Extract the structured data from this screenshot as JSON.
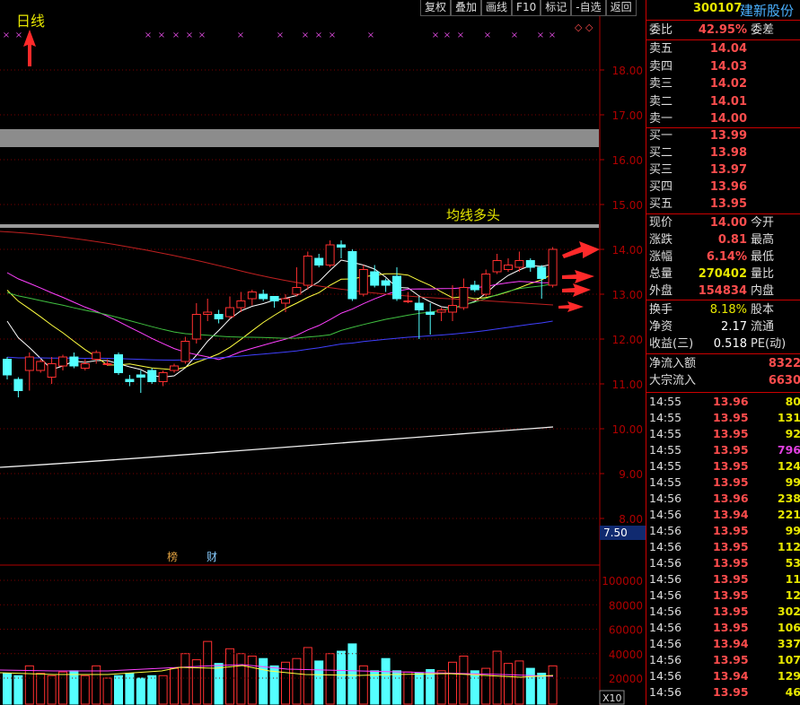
{
  "toolbar": {
    "buttons": [
      "复权",
      "叠加",
      "画线",
      "F10",
      "标记",
      "-自选",
      "返回"
    ]
  },
  "chart": {
    "period_label": "日线",
    "annotation": "均线多头",
    "price_axis": [
      "18.00",
      "17.00",
      "16.00",
      "15.00",
      "14.00",
      "13.00",
      "12.00",
      "11.00",
      "10.00",
      "9.00",
      "8.00"
    ],
    "price_tag": "7.50",
    "event_marks": [
      "榜",
      "财"
    ],
    "volume_axis": [
      "100000",
      "80000",
      "60000",
      "40000",
      "20000"
    ],
    "volume_unit": "X10"
  },
  "quote": {
    "code": "300107",
    "name": "建新股份",
    "weibi_label": "委比",
    "weibi_value": "42.95%",
    "weicha_label": "委差",
    "asks": [
      {
        "label": "卖五",
        "price": "14.04"
      },
      {
        "label": "卖四",
        "price": "14.03"
      },
      {
        "label": "卖三",
        "price": "14.02"
      },
      {
        "label": "卖二",
        "price": "14.01"
      },
      {
        "label": "卖一",
        "price": "14.00"
      }
    ],
    "bids": [
      {
        "label": "买一",
        "price": "13.99"
      },
      {
        "label": "买二",
        "price": "13.98"
      },
      {
        "label": "买三",
        "price": "13.97"
      },
      {
        "label": "买四",
        "price": "13.96"
      },
      {
        "label": "买五",
        "price": "13.95"
      }
    ],
    "stats1": [
      {
        "label": "现价",
        "value": "14.00",
        "label2": "今开"
      },
      {
        "label": "涨跌",
        "value": "0.81",
        "label2": "最高"
      },
      {
        "label": "涨幅",
        "value": "6.14%",
        "label2": "最低"
      },
      {
        "label": "总量",
        "value": "270402",
        "label2": "量比"
      },
      {
        "label": "外盘",
        "value": "154834",
        "label2": "内盘"
      }
    ],
    "stats2": [
      {
        "label": "换手",
        "value": "8.18%",
        "label2": "股本"
      },
      {
        "label": "净资",
        "value": "2.17",
        "label2": "流通"
      },
      {
        "label": "收益(三)",
        "value": "0.518",
        "label2": "PE(动)"
      }
    ],
    "flows": [
      {
        "label": "净流入额",
        "value": "8322"
      },
      {
        "label": "大宗流入",
        "value": "6630"
      }
    ],
    "ticks": [
      {
        "t": "14:55",
        "p": "13.96",
        "q": "80"
      },
      {
        "t": "14:55",
        "p": "13.95",
        "q": "131"
      },
      {
        "t": "14:55",
        "p": "13.95",
        "q": "92"
      },
      {
        "t": "14:55",
        "p": "13.95",
        "q": "796"
      },
      {
        "t": "14:55",
        "p": "13.95",
        "q": "124"
      },
      {
        "t": "14:55",
        "p": "13.95",
        "q": "99"
      },
      {
        "t": "14:56",
        "p": "13.96",
        "q": "238"
      },
      {
        "t": "14:56",
        "p": "13.94",
        "q": "221"
      },
      {
        "t": "14:56",
        "p": "13.95",
        "q": "99"
      },
      {
        "t": "14:56",
        "p": "13.95",
        "q": "112"
      },
      {
        "t": "14:56",
        "p": "13.95",
        "q": "53"
      },
      {
        "t": "14:56",
        "p": "13.95",
        "q": "11"
      },
      {
        "t": "14:56",
        "p": "13.95",
        "q": "12"
      },
      {
        "t": "14:56",
        "p": "13.95",
        "q": "302"
      },
      {
        "t": "14:56",
        "p": "13.95",
        "q": "106"
      },
      {
        "t": "14:56",
        "p": "13.94",
        "q": "337"
      },
      {
        "t": "14:56",
        "p": "13.95",
        "q": "107"
      },
      {
        "t": "14:56",
        "p": "13.94",
        "q": "129"
      },
      {
        "t": "14:56",
        "p": "13.95",
        "q": "46"
      }
    ]
  },
  "colors": {
    "up": "#ff3030",
    "down": "#54ffff",
    "ma5": "#ffffff",
    "ma10": "#ffff40",
    "ma20": "#ff40ff",
    "ma30": "#40c040",
    "ma60": "#4040ff",
    "ma120": "#c02020"
  }
}
